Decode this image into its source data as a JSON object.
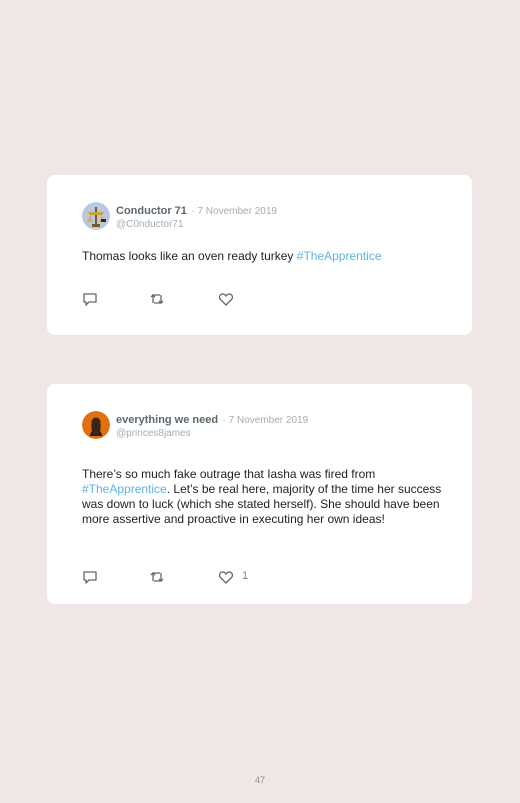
{
  "tweets": [
    {
      "name": "Conductor 71",
      "date": "· 7 November 2019",
      "handle": "@C0nductor71",
      "text_before": "Thomas looks like an oven ready turkey ",
      "hashtag": "#TheApprentice",
      "text_after": "",
      "like_count": "",
      "icons": [
        "reply-icon",
        "retweet-icon",
        "like-icon"
      ]
    },
    {
      "name": "everything we need",
      "date": "· 7 November 2019",
      "handle": "@princes8james",
      "text_before": "There’s so much fake outrage that Iasha was fired from ",
      "hashtag": "#TheApprentice",
      "text_after": ". Let’s be real here, majority of the time her success was down to luck (which she stated herself). She should have been more assertive and proactive in executing her own ideas!",
      "like_count": "1",
      "icons": [
        "reply-icon",
        "retweet-icon",
        "like-icon"
      ]
    }
  ],
  "page_number": "47",
  "colors": {
    "background": "#f0e6e6",
    "card": "#ffffff",
    "hashtag": "#5bb5de",
    "name": "#5c6870",
    "meta": "#a3adb4"
  }
}
